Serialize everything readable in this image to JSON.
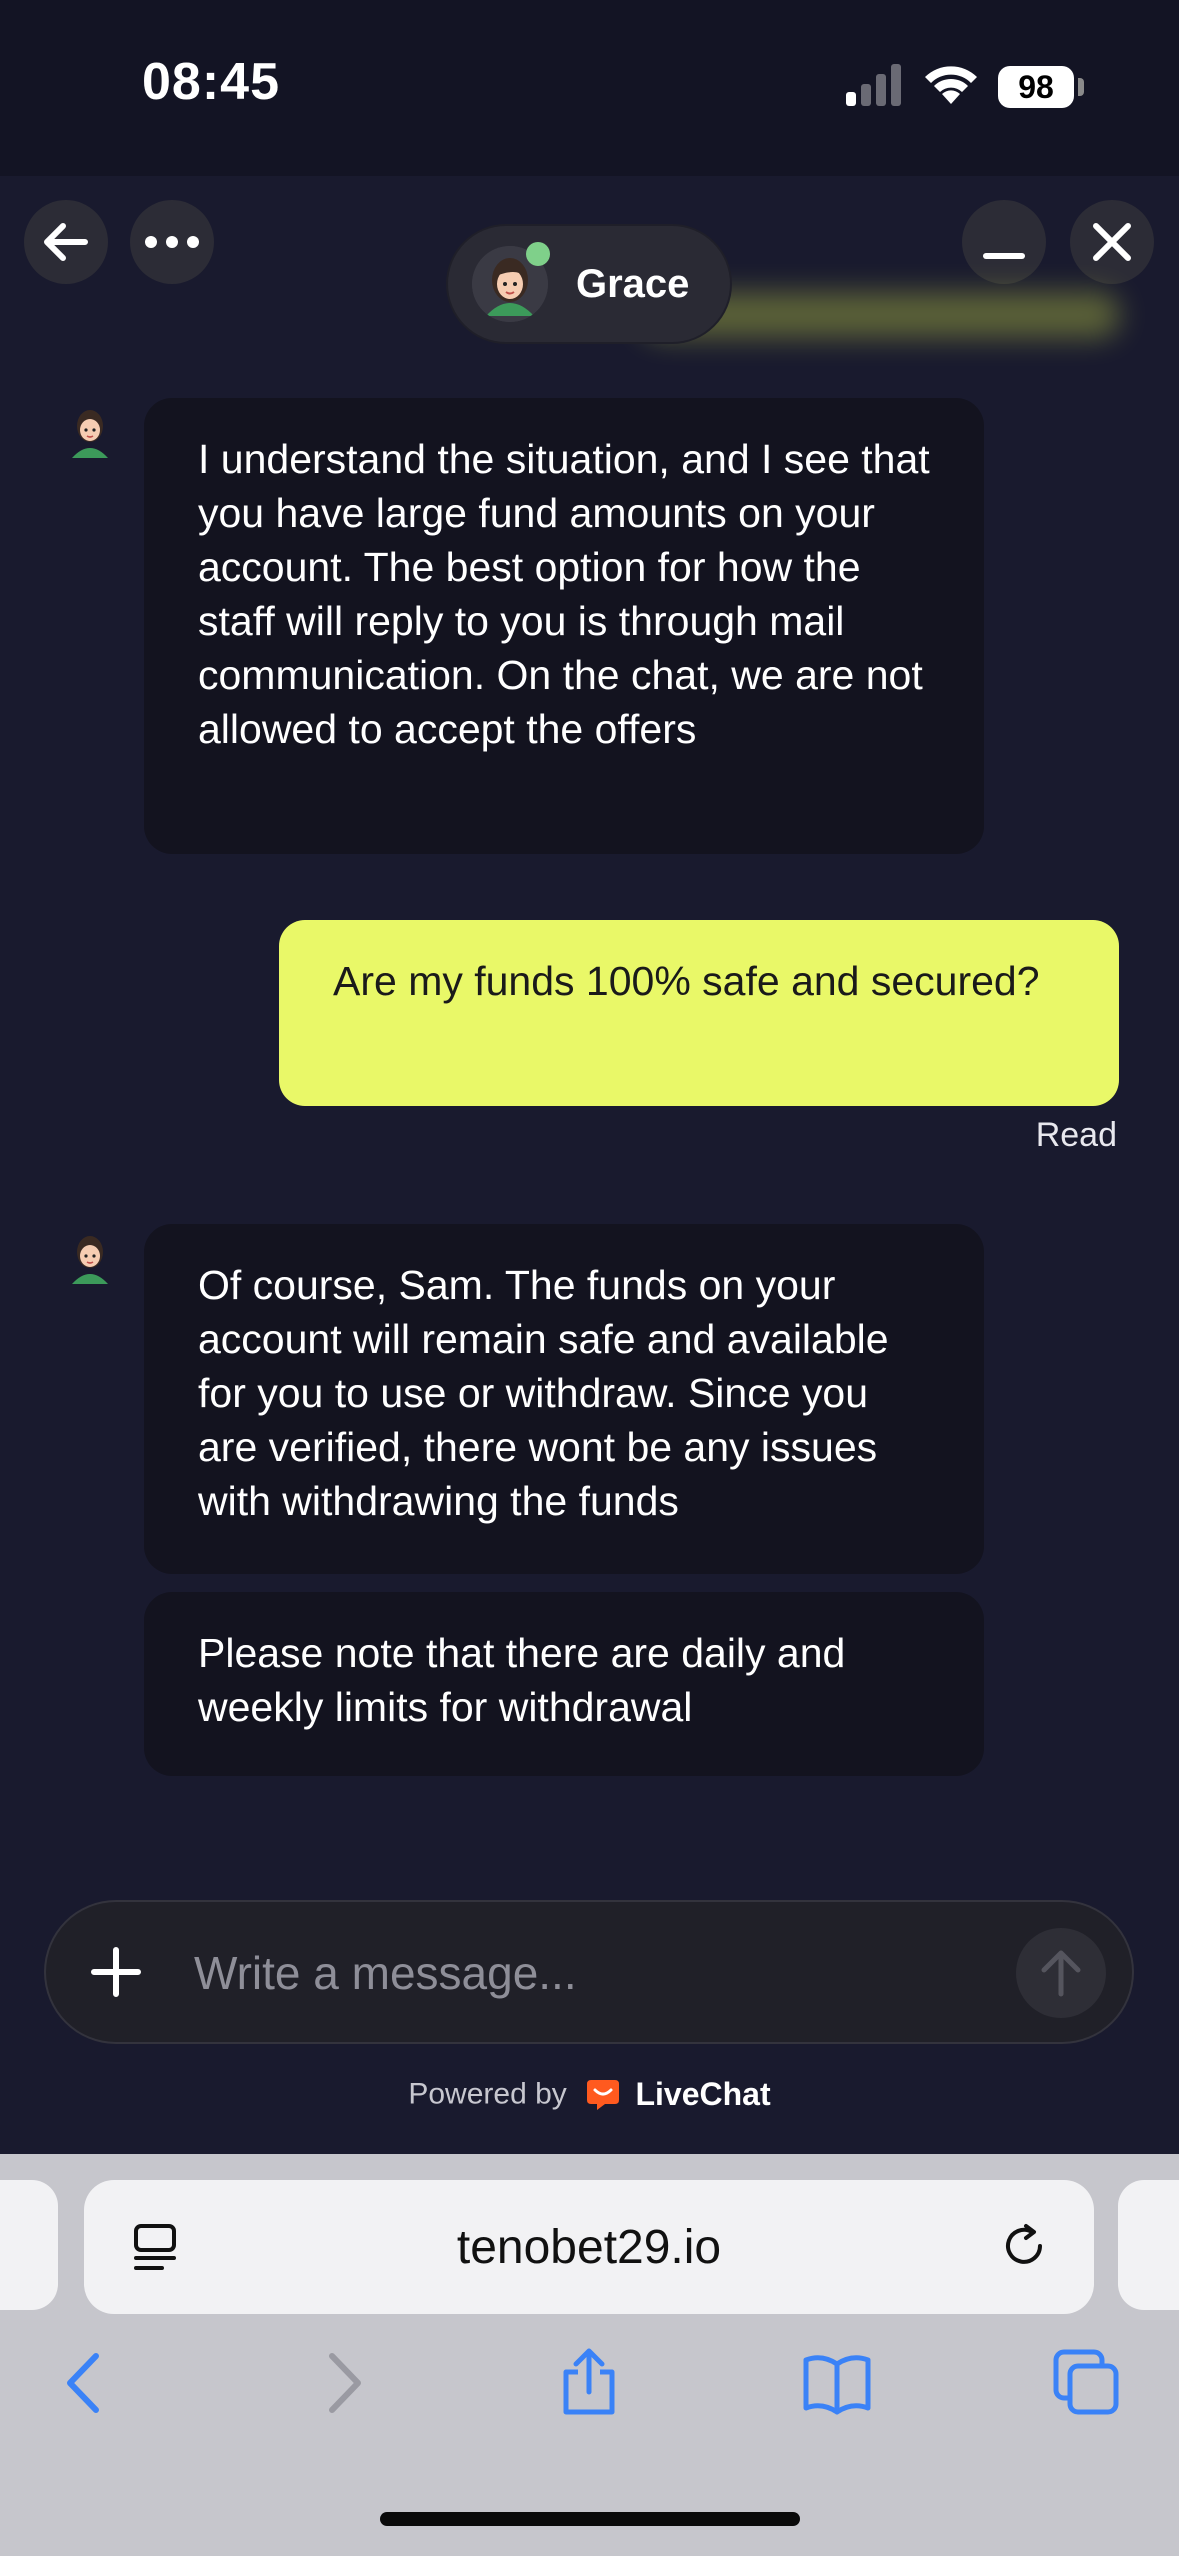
{
  "status_bar": {
    "time": "08:45",
    "battery": "98"
  },
  "chat_header": {
    "agent_name": "Grace",
    "agent_online": true
  },
  "messages": [
    {
      "sender": "agent",
      "text": "I understand the situation, and I see that you have large fund amounts on your account. The best option for how the staff will reply to you is through mail communication. On the chat, we are not allowed to accept the offers"
    },
    {
      "sender": "user",
      "text": "Are my funds 100% safe and secured?",
      "status": "Read"
    },
    {
      "sender": "agent",
      "text": "Of course, Sam. The funds on your account will remain safe and available for you to use or withdraw. Since you are verified, there wont be any issues with withdrawing the funds"
    },
    {
      "sender": "agent",
      "text": "Please note that there are daily and weekly limits for withdrawal"
    }
  ],
  "composer": {
    "placeholder": "Write a message..."
  },
  "footer": {
    "powered_by": "Powered by",
    "brand": "LiveChat"
  },
  "browser": {
    "url": "tenobet29.io"
  },
  "colors": {
    "background": "#191a2e",
    "agent_bubble": "#13131f",
    "user_bubble": "#e9f868",
    "livechat_brand": "#ff5a1f",
    "safari_accent": "#3a82f7",
    "online": "#7fd08a"
  }
}
